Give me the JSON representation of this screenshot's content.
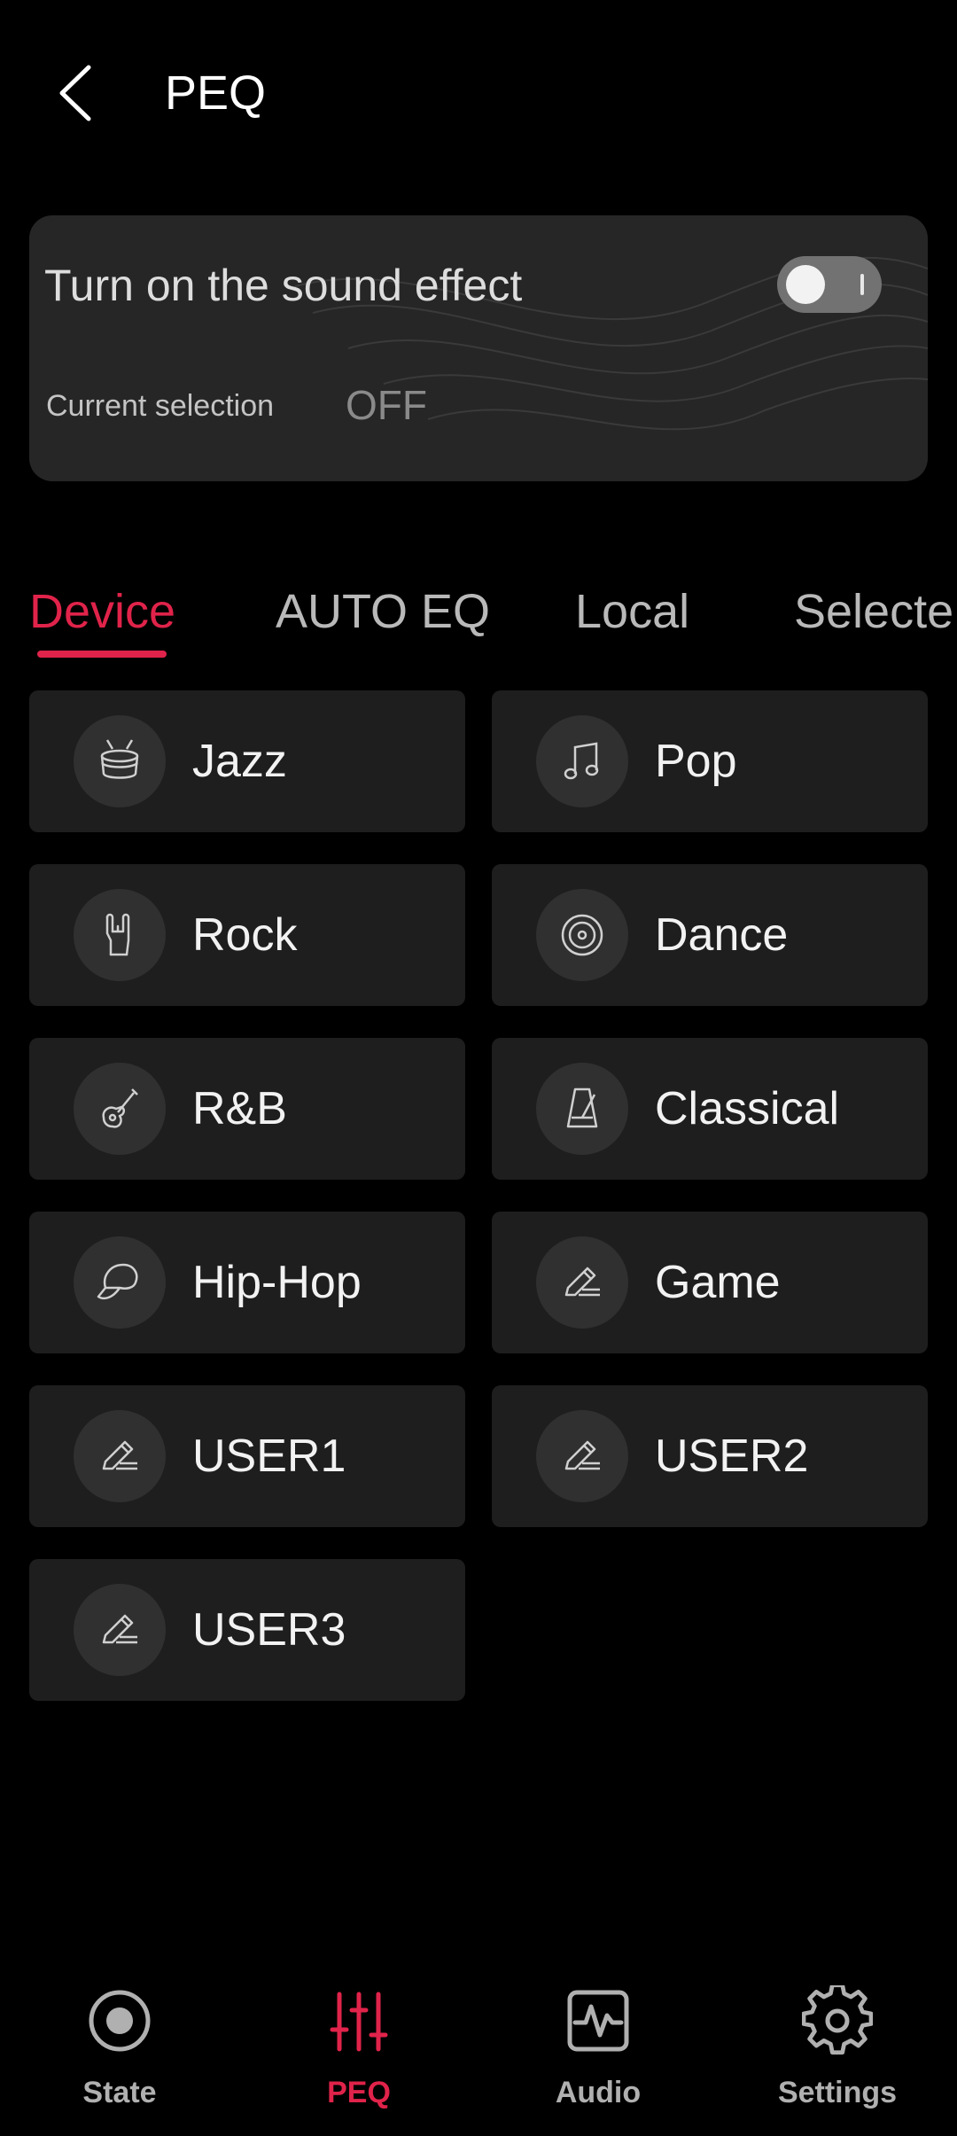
{
  "header": {
    "title": "PEQ"
  },
  "sound_effect": {
    "title": "Turn on the sound effect",
    "current_label": "Current selection",
    "current_value": "OFF",
    "enabled": false
  },
  "tabs": [
    {
      "label": "Device",
      "active": true
    },
    {
      "label": "AUTO EQ",
      "active": false
    },
    {
      "label": "Local",
      "active": false
    },
    {
      "label": "Selecte",
      "active": false
    }
  ],
  "presets": [
    {
      "label": "Jazz",
      "icon": "drum-icon"
    },
    {
      "label": "Pop",
      "icon": "music-note-icon"
    },
    {
      "label": "Rock",
      "icon": "rock-hand-icon"
    },
    {
      "label": "Dance",
      "icon": "vinyl-disc-icon"
    },
    {
      "label": "R&B",
      "icon": "guitar-icon"
    },
    {
      "label": "Classical",
      "icon": "metronome-icon"
    },
    {
      "label": "Hip-Hop",
      "icon": "cap-icon"
    },
    {
      "label": "Game",
      "icon": "edit-pencil-icon"
    },
    {
      "label": "USER1",
      "icon": "edit-pencil-icon"
    },
    {
      "label": "USER2",
      "icon": "edit-pencil-icon"
    },
    {
      "label": "USER3",
      "icon": "edit-pencil-icon"
    }
  ],
  "bottom_nav": [
    {
      "label": "State",
      "icon": "state-circle-icon",
      "active": false
    },
    {
      "label": "PEQ",
      "icon": "equalizer-sliders-icon",
      "active": true
    },
    {
      "label": "Audio",
      "icon": "audio-waveform-icon",
      "active": false
    },
    {
      "label": "Settings",
      "icon": "gear-icon",
      "active": false
    }
  ],
  "colors": {
    "accent": "#e0234a",
    "background": "#000000",
    "card": "#1e1e1e"
  }
}
